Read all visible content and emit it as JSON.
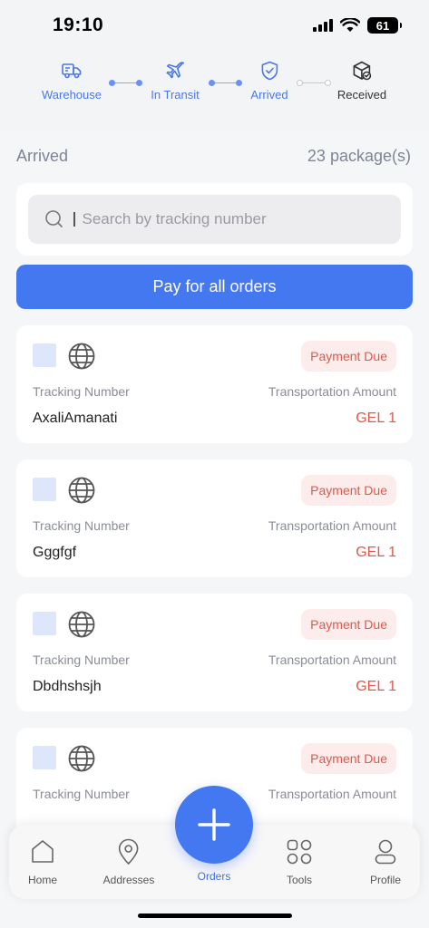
{
  "status": {
    "time": "19:10",
    "battery": "61"
  },
  "stepper": [
    {
      "label": "Warehouse",
      "icon": "truck-icon",
      "active": true
    },
    {
      "label": "In Transit",
      "icon": "airplane-icon",
      "active": true
    },
    {
      "label": "Arrived",
      "icon": "shield-check-icon",
      "active": true
    },
    {
      "label": "Received",
      "icon": "box-check-icon",
      "active": false
    }
  ],
  "summary": {
    "title": "Arrived",
    "count": "23 package(s)"
  },
  "search": {
    "placeholder": "Search by tracking number",
    "value": ""
  },
  "pay_all_label": "Pay for all orders",
  "orders": [
    {
      "status": "Payment Due",
      "tracking_label": "Tracking Number",
      "amount_label": "Transportation Amount",
      "tracking": "AxaliAmanati",
      "amount": "GEL 1"
    },
    {
      "status": "Payment Due",
      "tracking_label": "Tracking Number",
      "amount_label": "Transportation Amount",
      "tracking": "Gggfgf",
      "amount": "GEL 1"
    },
    {
      "status": "Payment Due",
      "tracking_label": "Tracking Number",
      "amount_label": "Transportation Amount",
      "tracking": "Dbdhshsjh",
      "amount": "GEL 1"
    },
    {
      "status": "Payment Due",
      "tracking_label": "Tracking Number",
      "amount_label": "Transportation Amount",
      "tracking": "",
      "amount": ""
    }
  ],
  "tabs": [
    {
      "label": "Home",
      "icon": "home-icon",
      "active": false
    },
    {
      "label": "Addresses",
      "icon": "location-pin-icon",
      "active": false
    },
    {
      "label": "Orders",
      "icon": "plus-icon",
      "active": true
    },
    {
      "label": "Tools",
      "icon": "grid-icon",
      "active": false
    },
    {
      "label": "Profile",
      "icon": "user-icon",
      "active": false
    }
  ],
  "colors": {
    "accent": "#4478f0",
    "danger": "#e0584a",
    "badge_bg": "#fdecec"
  }
}
